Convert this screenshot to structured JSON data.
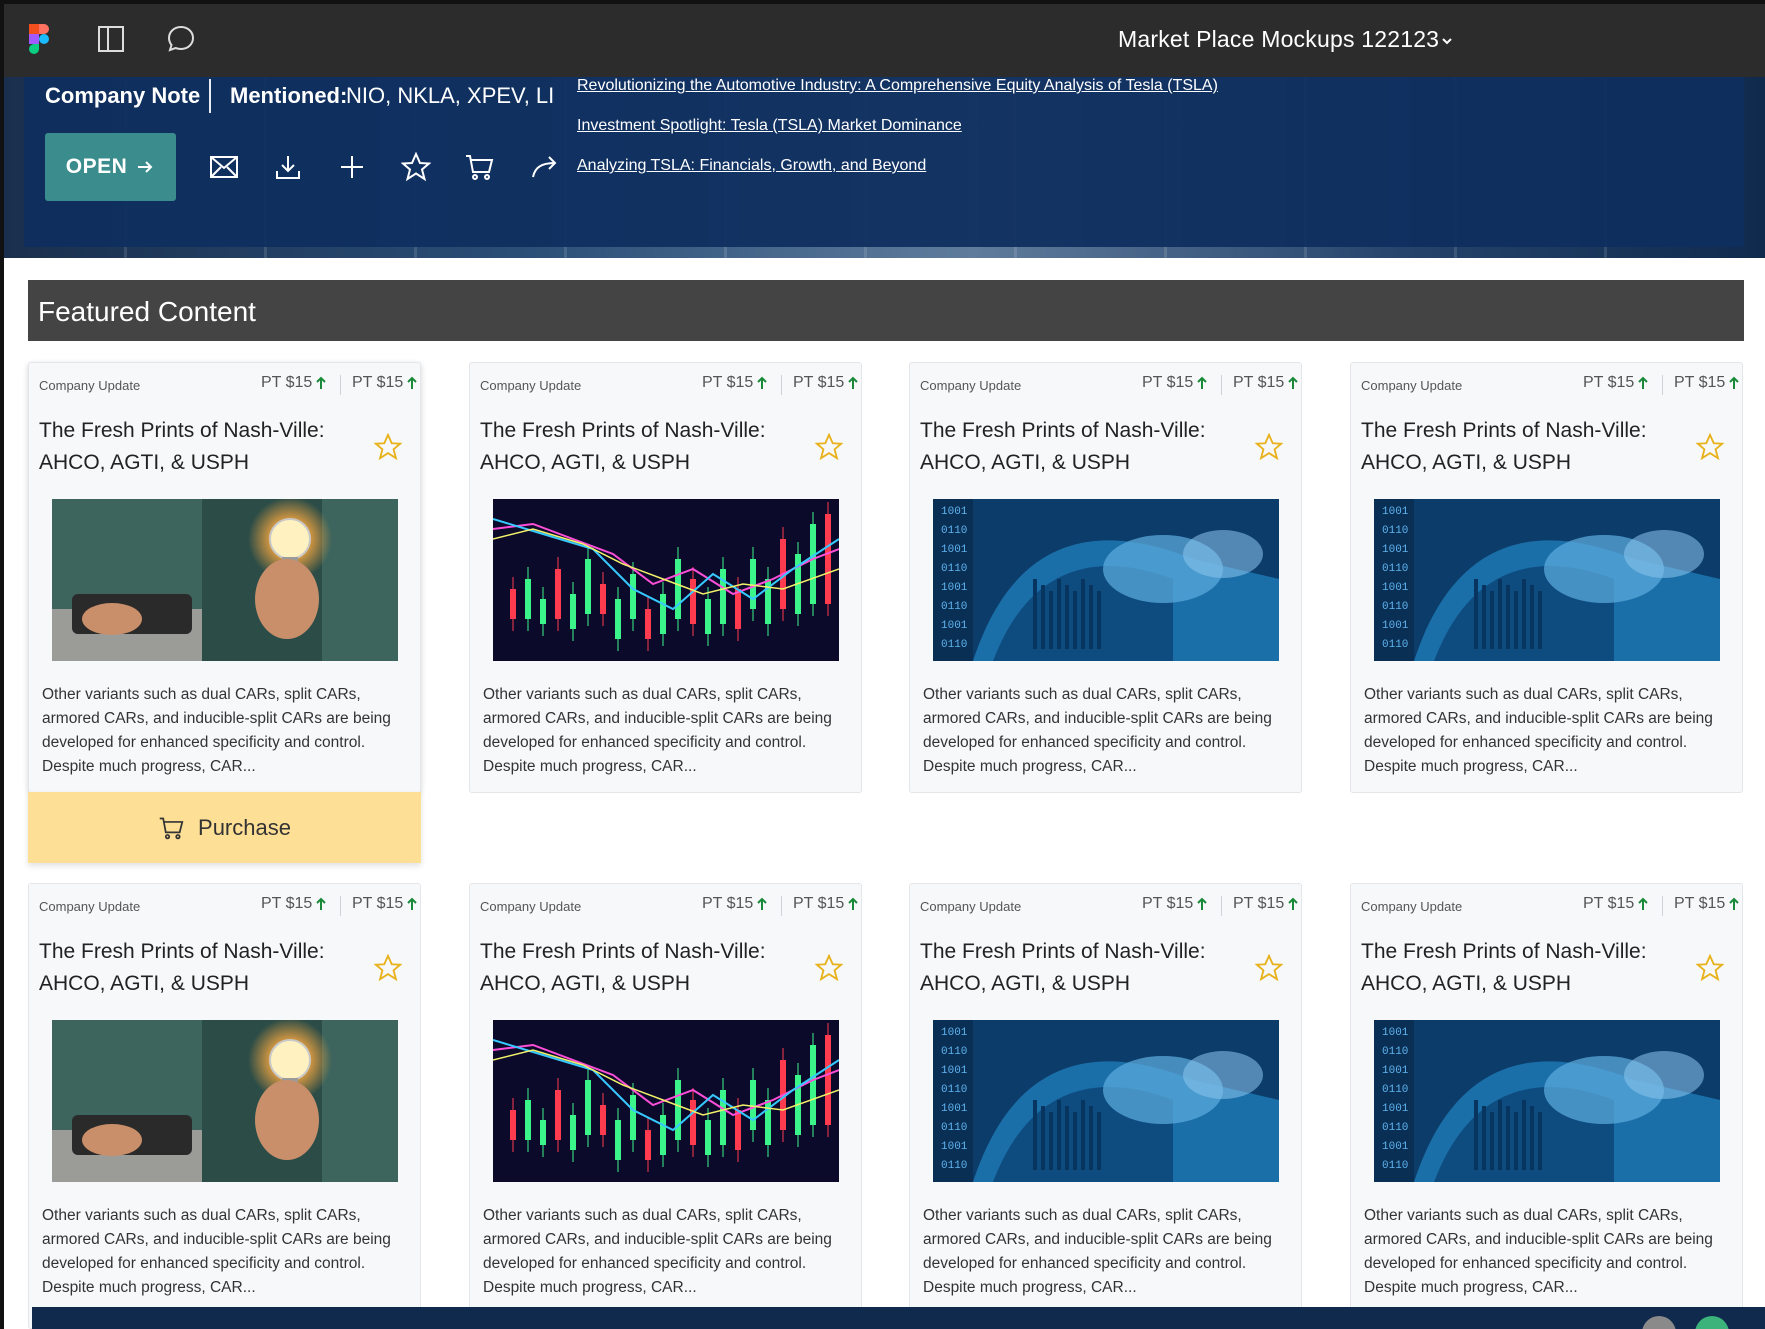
{
  "app": {
    "file_title": "Market Place Mockups 122123"
  },
  "hero": {
    "company_note": "Company Note",
    "mentioned_label": "Mentioned:",
    "mentioned_tickers": "NIO, NKLA, XPEV, LI",
    "open_label": "OPEN",
    "links": [
      "Revolutionizing the Automotive Industry: A Comprehensive Equity Analysis of Tesla (TSLA)",
      "Investment Spotlight: Tesla (TSLA) Market Dominance",
      "Analyzing TSLA: Financials, Growth, and Beyond"
    ]
  },
  "featured": {
    "title": "Featured Content",
    "purchase_label": "Purchase",
    "cards": [
      {
        "label": "Company Update",
        "pt1": "PT $15",
        "pt2": "PT $15",
        "title": "The Fresh Prints of Nash-Ville: AHCO, AGTI, & USPH",
        "image": "lightbulb-hand",
        "desc": "Other variants such as dual CARs, split CARs, armored CARs, and inducible-split CARs are being developed for enhanced specificity and control. Despite much progress, CAR..."
      },
      {
        "label": "Company Update",
        "pt1": "PT $15",
        "pt2": "PT $15",
        "title": "The Fresh Prints of Nash-Ville: AHCO, AGTI, & USPH",
        "image": "candlestick-chart",
        "desc": "Other variants such as dual CARs, split CARs, armored CARs, and inducible-split CARs are being developed for enhanced specificity and control. Despite much progress, CAR..."
      },
      {
        "label": "Company Update",
        "pt1": "PT $15",
        "pt2": "PT $15",
        "title": "The Fresh Prints of Nash-Ville: AHCO, AGTI, & USPH",
        "image": "blue-money",
        "desc": "Other variants such as dual CARs, split CARs, armored CARs, and inducible-split CARs are being developed for enhanced specificity and control. Despite much progress, CAR..."
      },
      {
        "label": "Company Update",
        "pt1": "PT $15",
        "pt2": "PT $15",
        "title": "The Fresh Prints of Nash-Ville: AHCO, AGTI, & USPH",
        "image": "blue-money",
        "desc": "Other variants such as dual CARs, split CARs, armored CARs, and inducible-split CARs are being developed for enhanced specificity and control. Despite much progress, CAR..."
      },
      {
        "label": "Company Update",
        "pt1": "PT $15",
        "pt2": "PT $15",
        "title": "The Fresh Prints of Nash-Ville: AHCO, AGTI, & USPH",
        "image": "lightbulb-hand",
        "desc": "Other variants such as dual CARs, split CARs, armored CARs, and inducible-split CARs are being developed for enhanced specificity and control. Despite much progress, CAR..."
      },
      {
        "label": "Company Update",
        "pt1": "PT $15",
        "pt2": "PT $15",
        "title": "The Fresh Prints of Nash-Ville: AHCO, AGTI, & USPH",
        "image": "candlestick-chart",
        "desc": "Other variants such as dual CARs, split CARs, armored CARs, and inducible-split CARs are being developed for enhanced specificity and control. Despite much progress, CAR..."
      },
      {
        "label": "Company Update",
        "pt1": "PT $15",
        "pt2": "PT $15",
        "title": "The Fresh Prints of Nash-Ville: AHCO, AGTI, & USPH",
        "image": "blue-money",
        "desc": "Other variants such as dual CARs, split CARs, armored CARs, and inducible-split CARs are being developed for enhanced specificity and control. Despite much progress, CAR..."
      },
      {
        "label": "Company Update",
        "pt1": "PT $15",
        "pt2": "PT $15",
        "title": "The Fresh Prints of Nash-Ville: AHCO, AGTI, & USPH",
        "image": "blue-money",
        "desc": "Other variants such as dual CARs, split CARs, armored CARs, and inducible-split CARs are being developed for enhanced specificity and control. Despite much progress, CAR..."
      }
    ]
  },
  "colors": {
    "toolbar": "#2c2c2c",
    "hero_panel": "#0e2e5f",
    "open_button": "#3b8c8c",
    "featured_header": "#444444",
    "purchase": "#fddf96",
    "star": "#e8b21c",
    "up_arrow": "#1a8a3a"
  }
}
